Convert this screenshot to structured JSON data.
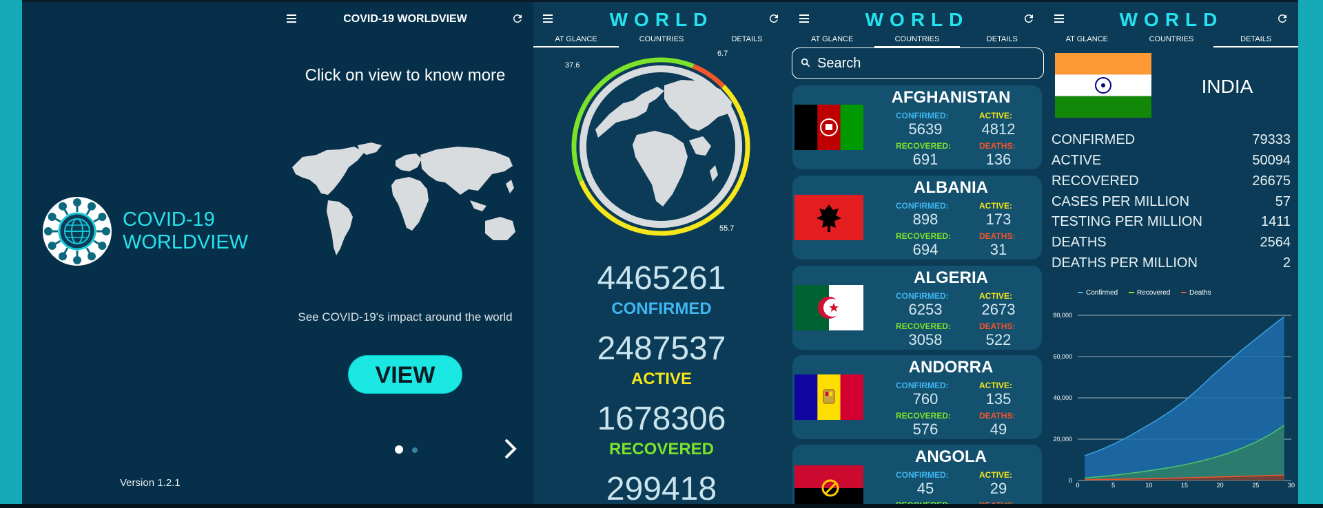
{
  "splash": {
    "app_title_line1": "COVID-19",
    "app_title_line2": "WORLDVIEW",
    "version": "Version 1.2.1"
  },
  "intro": {
    "title": "COVID-19 WORLDVIEW",
    "click_text": "Click on view to know more",
    "impact_text": "See COVID-19's impact around the world",
    "view_label": "VIEW"
  },
  "header": {
    "world": "WORLD"
  },
  "tabs": [
    "AT GLANCE",
    "COUNTRIES",
    "DETAILS"
  ],
  "glance": {
    "ring_labels": [
      "37.6",
      "6.7",
      "55.7"
    ],
    "ring_fractions": {
      "recovered": 0.376,
      "deaths": 0.067,
      "active": 0.557
    },
    "confirmed": "4465261",
    "confirmed_label": "CONFIRMED",
    "active": "2487537",
    "active_label": "ACTIVE",
    "recovered": "1678306",
    "recovered_label": "RECOVERED",
    "deaths": "299418"
  },
  "countries": {
    "search_placeholder": "Search",
    "labels": {
      "confirmed": "CONFIRMED:",
      "active": "ACTIVE:",
      "recovered": "RECOVERED:",
      "deaths": "DEATHS:"
    },
    "list": [
      {
        "name": "AFGHANISTAN",
        "confirmed": "5639",
        "active": "4812",
        "recovered": "691",
        "deaths": "136"
      },
      {
        "name": "ALBANIA",
        "confirmed": "898",
        "active": "173",
        "recovered": "694",
        "deaths": "31"
      },
      {
        "name": "ALGERIA",
        "confirmed": "6253",
        "active": "2673",
        "recovered": "3058",
        "deaths": "522"
      },
      {
        "name": "ANDORRA",
        "confirmed": "760",
        "active": "135",
        "recovered": "576",
        "deaths": "49"
      },
      {
        "name": "ANGOLA",
        "confirmed": "45",
        "active": "29",
        "recovered": "",
        "deaths": ""
      }
    ]
  },
  "details": {
    "country": "INDIA",
    "rows": [
      {
        "label": "CONFIRMED",
        "value": "79333"
      },
      {
        "label": "ACTIVE",
        "value": "50094"
      },
      {
        "label": "RECOVERED",
        "value": "26675"
      },
      {
        "label": "CASES PER MILLION",
        "value": "57"
      },
      {
        "label": "TESTING PER MILLION",
        "value": "1411"
      },
      {
        "label": "DEATHS",
        "value": "2564"
      },
      {
        "label": "DEATHS PER MILLION",
        "value": "2"
      }
    ]
  },
  "colors": {
    "confirmed": "#3fb6f0",
    "active": "#f6e61a",
    "recovered": "#7de32a",
    "deaths": "#f2562b",
    "accent": "#25e2ee"
  },
  "chart_data": {
    "type": "area",
    "legend": [
      "Confirmed",
      "Recovered",
      "Deaths"
    ],
    "legend_position": "top",
    "xlim": [
      0,
      30
    ],
    "ylim": [
      0,
      80000
    ],
    "x_ticks": [
      "0",
      "5",
      "10",
      "15",
      "20",
      "25",
      "30"
    ],
    "y_ticks": [
      "0",
      "20,000",
      "40,000",
      "60,000",
      "80,000"
    ],
    "x": [
      1,
      3,
      5,
      7,
      9,
      11,
      13,
      15,
      17,
      19,
      21,
      23,
      25,
      27,
      29
    ],
    "series": [
      {
        "name": "Confirmed",
        "values": [
          12000,
          14500,
          17500,
          21000,
          25000,
          29000,
          33500,
          38500,
          44500,
          51000,
          57000,
          63000,
          68500,
          74000,
          79333
        ]
      },
      {
        "name": "Recovered",
        "values": [
          1200,
          1800,
          2500,
          3300,
          4200,
          5200,
          6300,
          7600,
          9100,
          10900,
          13000,
          15600,
          18500,
          22200,
          26675
        ]
      },
      {
        "name": "Deaths",
        "values": [
          400,
          480,
          570,
          680,
          800,
          940,
          1100,
          1280,
          1450,
          1640,
          1840,
          2040,
          2220,
          2400,
          2564
        ]
      }
    ],
    "grid": "horizontal"
  }
}
